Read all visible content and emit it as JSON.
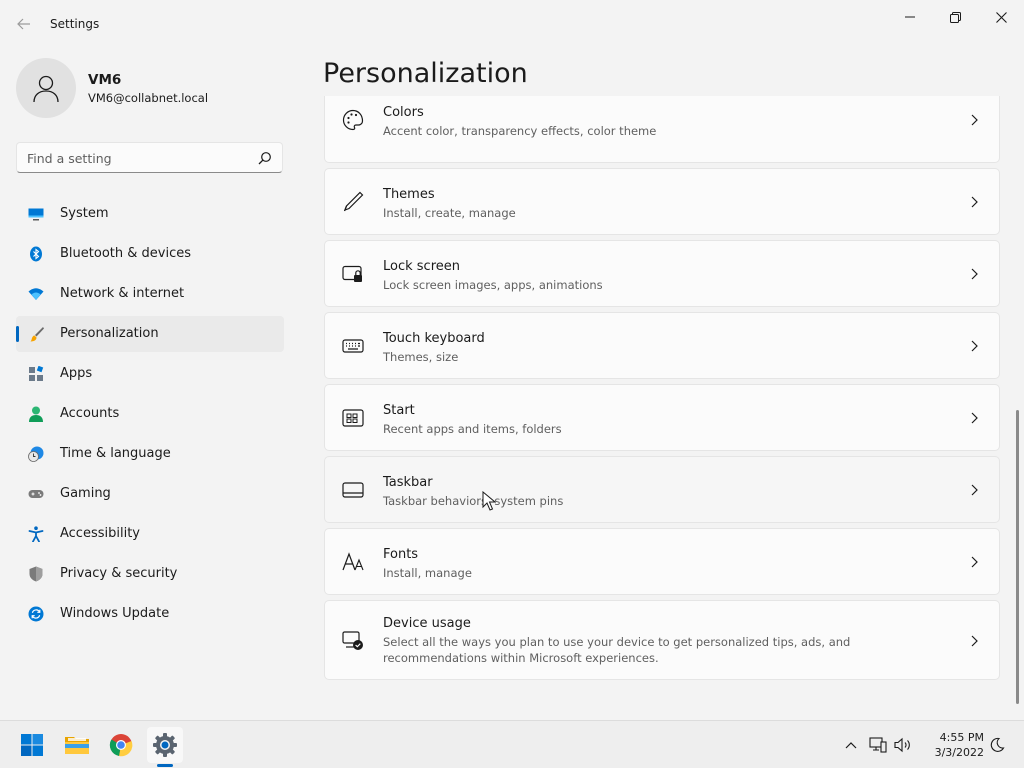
{
  "window": {
    "title": "Settings"
  },
  "user": {
    "name": "VM6",
    "email": "VM6@collabnet.local"
  },
  "search": {
    "placeholder": "Find a setting"
  },
  "sidebar": {
    "items": [
      {
        "label": "System",
        "icon": "system-icon"
      },
      {
        "label": "Bluetooth & devices",
        "icon": "bluetooth-icon"
      },
      {
        "label": "Network & internet",
        "icon": "wifi-icon"
      },
      {
        "label": "Personalization",
        "icon": "brush-icon",
        "active": true
      },
      {
        "label": "Apps",
        "icon": "apps-icon"
      },
      {
        "label": "Accounts",
        "icon": "accounts-icon"
      },
      {
        "label": "Time & language",
        "icon": "clock-globe-icon"
      },
      {
        "label": "Gaming",
        "icon": "gamepad-icon"
      },
      {
        "label": "Accessibility",
        "icon": "accessibility-icon"
      },
      {
        "label": "Privacy & security",
        "icon": "shield-icon"
      },
      {
        "label": "Windows Update",
        "icon": "update-icon"
      }
    ]
  },
  "main": {
    "title": "Personalization",
    "cards": [
      {
        "title": "Colors",
        "subtitle": "Accent color, transparency effects, color theme",
        "icon": "palette-icon"
      },
      {
        "title": "Themes",
        "subtitle": "Install, create, manage",
        "icon": "pen-icon"
      },
      {
        "title": "Lock screen",
        "subtitle": "Lock screen images, apps, animations",
        "icon": "lock-screen-icon"
      },
      {
        "title": "Touch keyboard",
        "subtitle": "Themes, size",
        "icon": "keyboard-icon"
      },
      {
        "title": "Start",
        "subtitle": "Recent apps and items, folders",
        "icon": "start-icon"
      },
      {
        "title": "Taskbar",
        "subtitle": "Taskbar behaviors, system pins",
        "icon": "taskbar-icon"
      },
      {
        "title": "Fonts",
        "subtitle": "Install, manage",
        "icon": "fonts-icon"
      },
      {
        "title": "Device usage",
        "subtitle": "Select all the ways you plan to use your device to get personalized tips, ads, and recommendations within Microsoft experiences.",
        "icon": "device-usage-icon"
      }
    ]
  },
  "taskbar": {
    "apps": [
      "windows-start-icon",
      "file-explorer-icon",
      "chrome-icon",
      "settings-icon"
    ],
    "time": "4:55 PM",
    "date": "3/3/2022"
  },
  "colors": {
    "accent": "#0067c0",
    "background": "#f3f3f3",
    "card": "#fbfbfb"
  }
}
